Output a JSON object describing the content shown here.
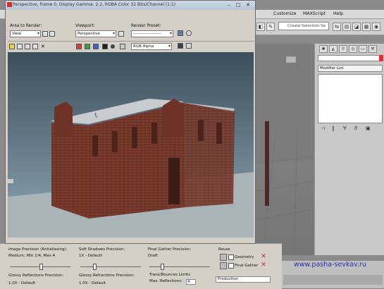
{
  "frame_window": {
    "title": "Perspective, frame 0, Display Gamma: 2.2, RGBA Color 32 Bits/Channel (1:1)",
    "area_to_render_label": "Area to Render:",
    "area_to_render_value": "View",
    "viewport_label": "Viewport:",
    "viewport_value": "Perspective",
    "render_preset_label": "Render Preset:",
    "render_preset_value": "--------------------",
    "channel_value": "RGB Alpha"
  },
  "max_menu": {
    "items": [
      "Customize",
      "MAXScript",
      "Help"
    ],
    "selection_set_placeholder": "Create Selection Se"
  },
  "command_panel": {
    "modifier_list": "Modifier List"
  },
  "render_panel": {
    "image_precision_label": "Image Precision (Antialiasing):",
    "image_precision_value": "Medium: Min 1/4, Max 4",
    "soft_shadows_label": "Soft Shadows Precision:",
    "soft_shadows_value": "1X - Default",
    "final_gather_label": "Final Gather Precision:",
    "final_gather_value": "Draft",
    "reuse_label": "Reuse",
    "geometry_label": "Geometry",
    "final_gather_check_label": "Final Gather",
    "glossy_reflections_label": "Glossy Reflections Precision:",
    "glossy_reflections_value": "1.0X - Default",
    "glossy_refractions_label": "Glossy Refractions Precision:",
    "glossy_refractions_value": "1.0X - Default",
    "trace_label": "Trace/Bounces Limits",
    "max_reflections_label": "Max. Reflections:",
    "max_reflections_value": "4",
    "preset_value": "Production"
  },
  "watermark": "www.pasha-sevkav.ru",
  "colors": {
    "sky_top": "#3c4f5c",
    "sky_bottom": "#8ea6b4",
    "brick": "#7a3b2c",
    "roof": "#c8ccd0",
    "ground": "#a8b4b8",
    "watermark": "#2233aa"
  }
}
